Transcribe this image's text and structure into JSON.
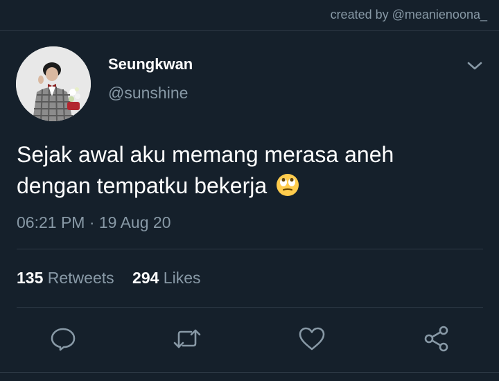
{
  "credit": "created by @meanienoona_",
  "user": {
    "name": "Seungkwan",
    "handle": "@sunshine"
  },
  "tweet": {
    "text_line1": "Sejak awal aku memang merasa aneh",
    "text_line2": "dengan tempatku bekerja",
    "emoji": "face-with-rolling-eyes",
    "timestamp": "06:21 PM · 19 Aug 20"
  },
  "stats": {
    "retweets_count": "135",
    "retweets_label": "Retweets",
    "likes_count": "294",
    "likes_label": "Likes"
  },
  "icons": [
    "chevron-down-icon",
    "reply-icon",
    "retweet-icon",
    "like-icon",
    "share-icon"
  ],
  "colors": {
    "background": "#15202b",
    "secondary_text": "#8899a6",
    "divider": "#2f3b47",
    "primary_text": "#ffffff"
  }
}
